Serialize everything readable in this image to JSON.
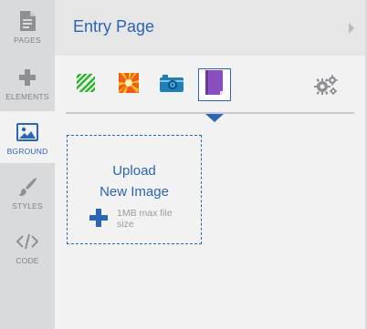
{
  "rail": {
    "items": [
      {
        "label": "PAGES",
        "icon": "page-icon"
      },
      {
        "label": "ELEMENTS",
        "icon": "plus-icon"
      },
      {
        "label": "BGROUND",
        "icon": "image-icon",
        "active": true
      },
      {
        "label": "STYLES",
        "icon": "brush-icon"
      },
      {
        "label": "CODE",
        "icon": "code-icon"
      }
    ]
  },
  "header": {
    "title": "Entry Page"
  },
  "bg_types": [
    {
      "icon": "stripes-pattern-icon"
    },
    {
      "icon": "burst-pattern-icon"
    },
    {
      "icon": "camera-icon"
    },
    {
      "icon": "book-icon",
      "selected": true
    }
  ],
  "upload": {
    "line1": "Upload",
    "line2": "New Image",
    "note": "1MB max file size"
  },
  "colors": {
    "accent": "#2a65b8",
    "rail_bg": "#d9dadc",
    "panel_bg": "#f2f2f2"
  }
}
